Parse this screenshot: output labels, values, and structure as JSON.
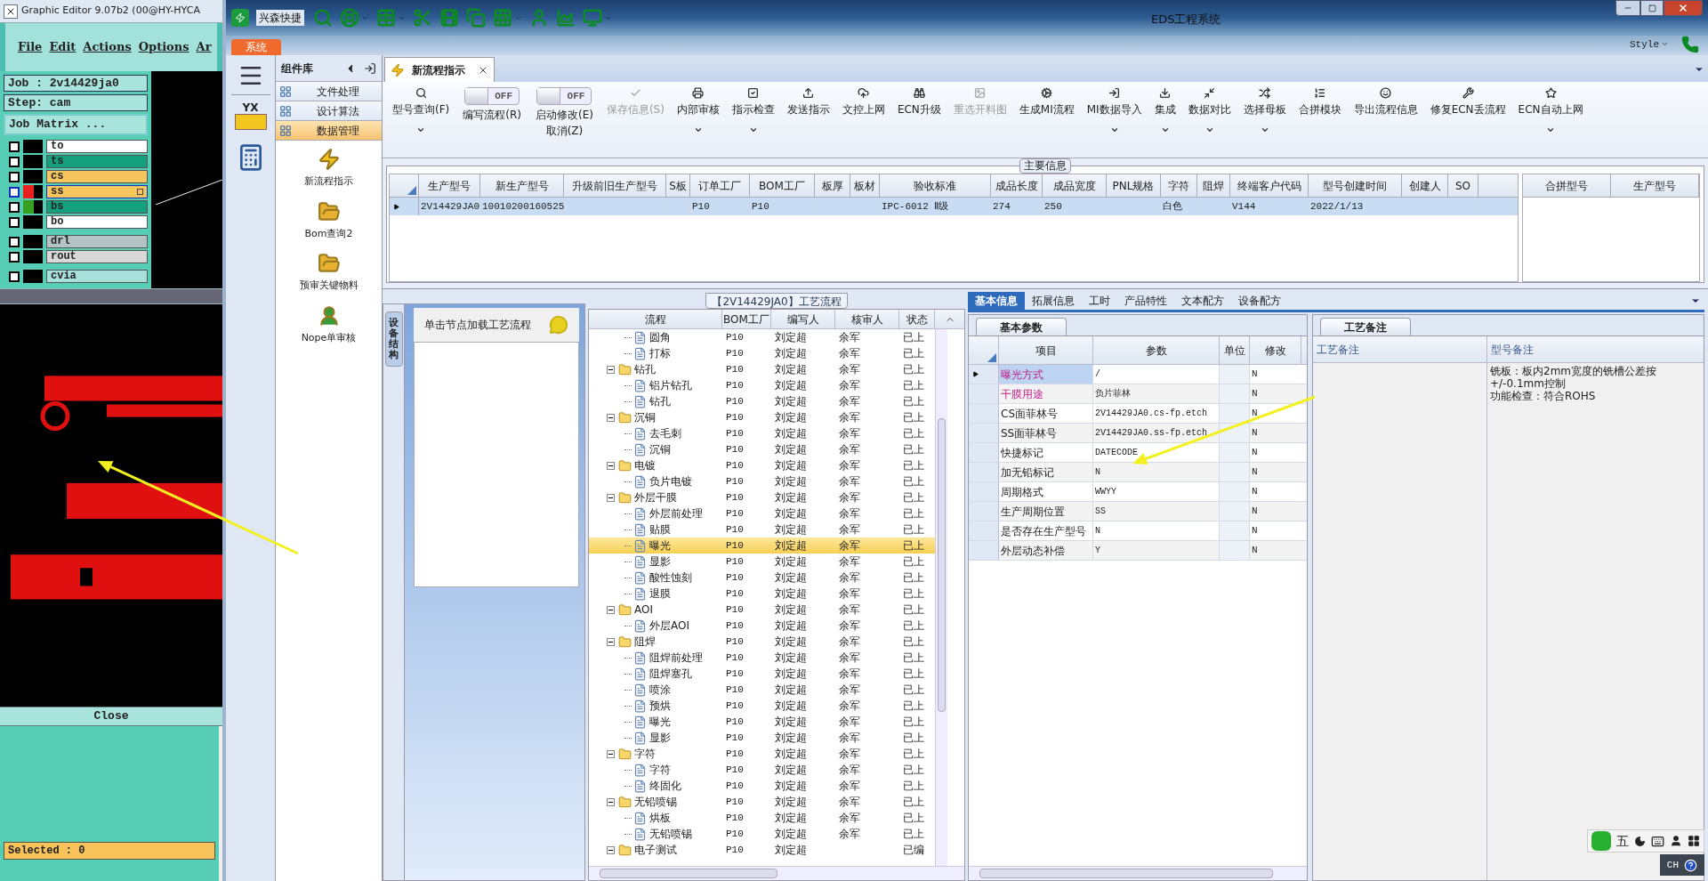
{
  "cam_window": {
    "title": "Graphic Editor 9.07b2 (00@HY-HYCA",
    "menu": [
      "File",
      "Edit",
      "Actions",
      "Options",
      "Ar"
    ],
    "job": "Job : 2v14429ja0",
    "step": "Step: cam",
    "job_matrix_button": "Job Matrix ...",
    "layers": [
      {
        "name": "to",
        "color": "#ffffff",
        "selected": false,
        "checked": false
      },
      {
        "name": "ts",
        "color": "#14a07c",
        "selected": false,
        "checked": false
      },
      {
        "name": "cs",
        "color": "#f7c55e",
        "selected": false,
        "checked": false
      },
      {
        "name": "ss",
        "color": "#f7c55e",
        "selected": true,
        "checked": false,
        "swatch": {
          "color": "#e82020"
        }
      },
      {
        "name": "bs",
        "color": "#14a07c",
        "selected": false,
        "checked": false,
        "swatch": {
          "color": "#38a020"
        }
      },
      {
        "name": "bo",
        "color": "#ffffff",
        "selected": false,
        "checked": false
      },
      {
        "name": "drl",
        "color": "#b4c4c4",
        "selected": false,
        "checked": false
      },
      {
        "name": "rout",
        "color": "#d8d8d8",
        "selected": false,
        "checked": false
      },
      {
        "name": "cvia",
        "color": "#a8e0dc",
        "selected": false,
        "checked": false
      }
    ],
    "close_button": "Close",
    "selected_status": "Selected : 0"
  },
  "main_window": {
    "title": "EDS工程系统",
    "quick_toolbar_label": "兴森快捷",
    "system_tab": "系统",
    "style_menu": "Style",
    "logo_text": "YX"
  },
  "sidebar": {
    "title": "组件库",
    "groups": [
      {
        "label": "文件处理",
        "selected": false
      },
      {
        "label": "设计算法",
        "selected": false
      },
      {
        "label": "数据管理",
        "selected": true
      }
    ],
    "items": [
      "新流程指示",
      "Bom查询2",
      "预审关键物料",
      "Nope单审核"
    ]
  },
  "document_tab": {
    "label": "新流程指示"
  },
  "toolbar": [
    {
      "kind": "button",
      "label": "型号查询(F)",
      "dropdown": true,
      "disabled": false
    },
    {
      "kind": "toggle",
      "label": "编写流程(R)",
      "toggle_text": "OFF",
      "on": false
    },
    {
      "kind": "toggle",
      "label": "启动修改(E)",
      "sublabel": "取消(Z)",
      "toggle_text": "OFF",
      "on": false
    },
    {
      "kind": "button",
      "label": "保存信息(S)",
      "dropdown": false,
      "disabled": true
    },
    {
      "kind": "button",
      "label": "内部审核",
      "dropdown": true,
      "disabled": false
    },
    {
      "kind": "button",
      "label": "指示检查",
      "dropdown": true,
      "disabled": false
    },
    {
      "kind": "button",
      "label": "发送指示",
      "dropdown": false,
      "disabled": false
    },
    {
      "kind": "button",
      "label": "文控上网",
      "dropdown": false,
      "disabled": false
    },
    {
      "kind": "button",
      "label": "ECN升级",
      "dropdown": false,
      "disabled": false
    },
    {
      "kind": "button",
      "label": "重选开料图",
      "dropdown": false,
      "disabled": true
    },
    {
      "kind": "button",
      "label": "生成MI流程",
      "dropdown": false,
      "disabled": false
    },
    {
      "kind": "button",
      "label": "MI数据导入",
      "dropdown": true,
      "disabled": false
    },
    {
      "kind": "button",
      "label": "集成",
      "dropdown": true,
      "disabled": false
    },
    {
      "kind": "button",
      "label": "数据对比",
      "dropdown": true,
      "disabled": false
    },
    {
      "kind": "button",
      "label": "选择母板",
      "dropdown": true,
      "disabled": false
    },
    {
      "kind": "button",
      "label": "合拼模块",
      "dropdown": false,
      "disabled": false
    },
    {
      "kind": "button",
      "label": "导出流程信息",
      "dropdown": false,
      "disabled": false
    },
    {
      "kind": "button",
      "label": "修复ECN丢流程",
      "dropdown": false,
      "disabled": false
    },
    {
      "kind": "button",
      "label": "ECN自动上网",
      "dropdown": true,
      "disabled": false
    }
  ],
  "main_info": {
    "title": "主要信息",
    "columns": [
      "生产型号",
      "新生产型号",
      "升级前旧生产型号",
      "S板",
      "订单工厂",
      "BOM工厂",
      "板厚",
      "板材",
      "验收标准",
      "成品长度",
      "成品宽度",
      "PNL规格",
      "字符",
      "阻焊",
      "终端客户代码",
      "型号创建时间",
      "创建人",
      "SO"
    ],
    "rows": [
      {
        "selected": true,
        "cells": [
          "2V14429JA0",
          "10010200160525",
          "",
          "",
          "P10",
          "P10",
          "",
          "",
          "IPC-6012 Ⅱ级",
          "274",
          "250",
          "",
          "白色",
          "",
          "V144",
          "2022/1/13",
          "",
          ""
        ]
      }
    ],
    "merge_columns": [
      "合拼型号",
      "生产型号"
    ]
  },
  "flow_panel": {
    "side_tab": "设备结构",
    "hint": "单击节点加载工艺流程"
  },
  "flow_tree": {
    "title": "【2V14429JA0】工艺流程",
    "columns": [
      "流程",
      "BOM工厂",
      "编写人",
      "核审人",
      "状态"
    ],
    "nodes": [
      {
        "kind": "step",
        "name": "圆角",
        "bom": "P10",
        "writer": "刘定超",
        "reviewer": "余军",
        "status": "已上",
        "selected": false
      },
      {
        "kind": "step",
        "name": "打标",
        "bom": "P10",
        "writer": "刘定超",
        "reviewer": "余军",
        "status": "已上",
        "selected": false
      },
      {
        "kind": "folder",
        "name": "钻孔",
        "bom": "P10",
        "writer": "刘定超",
        "reviewer": "余军",
        "status": "已上",
        "selected": false,
        "expanded": true,
        "children": [
          {
            "kind": "step",
            "name": "铝片钻孔",
            "bom": "P10",
            "writer": "刘定超",
            "reviewer": "余军",
            "status": "已上",
            "selected": false
          },
          {
            "kind": "step",
            "name": "钻孔",
            "bom": "P10",
            "writer": "刘定超",
            "reviewer": "余军",
            "status": "已上",
            "selected": false
          }
        ]
      },
      {
        "kind": "folder",
        "name": "沉铜",
        "bom": "P10",
        "writer": "刘定超",
        "reviewer": "余军",
        "status": "已上",
        "selected": false,
        "expanded": true,
        "children": [
          {
            "kind": "step",
            "name": "去毛刺",
            "bom": "P10",
            "writer": "刘定超",
            "reviewer": "余军",
            "status": "已上",
            "selected": false
          },
          {
            "kind": "step",
            "name": "沉铜",
            "bom": "P10",
            "writer": "刘定超",
            "reviewer": "余军",
            "status": "已上",
            "selected": false
          }
        ]
      },
      {
        "kind": "folder",
        "name": "电镀",
        "bom": "P10",
        "writer": "刘定超",
        "reviewer": "余军",
        "status": "已上",
        "selected": false,
        "expanded": true,
        "children": [
          {
            "kind": "step",
            "name": "负片电镀",
            "bom": "P10",
            "writer": "刘定超",
            "reviewer": "余军",
            "status": "已上",
            "selected": false
          }
        ]
      },
      {
        "kind": "folder",
        "name": "外层干膜",
        "bom": "P10",
        "writer": "刘定超",
        "reviewer": "余军",
        "status": "已上",
        "selected": false,
        "expanded": true,
        "children": [
          {
            "kind": "step",
            "name": "外层前处理",
            "bom": "P10",
            "writer": "刘定超",
            "reviewer": "余军",
            "status": "已上",
            "selected": false
          },
          {
            "kind": "step",
            "name": "贴膜",
            "bom": "P10",
            "writer": "刘定超",
            "reviewer": "余军",
            "status": "已上",
            "selected": false
          },
          {
            "kind": "step",
            "name": "曝光",
            "bom": "P10",
            "writer": "刘定超",
            "reviewer": "余军",
            "status": "已上",
            "selected": true
          },
          {
            "kind": "step",
            "name": "显影",
            "bom": "P10",
            "writer": "刘定超",
            "reviewer": "余军",
            "status": "已上",
            "selected": false
          },
          {
            "kind": "step",
            "name": "酸性蚀刻",
            "bom": "P10",
            "writer": "刘定超",
            "reviewer": "余军",
            "status": "已上",
            "selected": false
          },
          {
            "kind": "step",
            "name": "退膜",
            "bom": "P10",
            "writer": "刘定超",
            "reviewer": "余军",
            "status": "已上",
            "selected": false
          }
        ]
      },
      {
        "kind": "folder",
        "name": "AOI",
        "bom": "P10",
        "writer": "刘定超",
        "reviewer": "余军",
        "status": "已上",
        "selected": false,
        "expanded": true,
        "children": [
          {
            "kind": "step",
            "name": "外层AOI",
            "bom": "P10",
            "writer": "刘定超",
            "reviewer": "余军",
            "status": "已上",
            "selected": false
          }
        ]
      },
      {
        "kind": "folder",
        "name": "阻焊",
        "bom": "P10",
        "writer": "刘定超",
        "reviewer": "余军",
        "status": "已上",
        "selected": false,
        "expanded": true,
        "children": [
          {
            "kind": "step",
            "name": "阻焊前处理",
            "bom": "P10",
            "writer": "刘定超",
            "reviewer": "余军",
            "status": "已上",
            "selected": false
          },
          {
            "kind": "step",
            "name": "阻焊塞孔",
            "bom": "P10",
            "writer": "刘定超",
            "reviewer": "余军",
            "status": "已上",
            "selected": false
          },
          {
            "kind": "step",
            "name": "喷涂",
            "bom": "P10",
            "writer": "刘定超",
            "reviewer": "余军",
            "status": "已上",
            "selected": false
          },
          {
            "kind": "step",
            "name": "预烘",
            "bom": "P10",
            "writer": "刘定超",
            "reviewer": "余军",
            "status": "已上",
            "selected": false
          },
          {
            "kind": "step",
            "name": "曝光",
            "bom": "P10",
            "writer": "刘定超",
            "reviewer": "余军",
            "status": "已上",
            "selected": false
          },
          {
            "kind": "step",
            "name": "显影",
            "bom": "P10",
            "writer": "刘定超",
            "reviewer": "余军",
            "status": "已上",
            "selected": false
          }
        ]
      },
      {
        "kind": "folder",
        "name": "字符",
        "bom": "P10",
        "writer": "刘定超",
        "reviewer": "余军",
        "status": "已上",
        "selected": false,
        "expanded": true,
        "children": [
          {
            "kind": "step",
            "name": "字符",
            "bom": "P10",
            "writer": "刘定超",
            "reviewer": "余军",
            "status": "已上",
            "selected": false
          },
          {
            "kind": "step",
            "name": "终固化",
            "bom": "P10",
            "writer": "刘定超",
            "reviewer": "余军",
            "status": "已上",
            "selected": false
          }
        ]
      },
      {
        "kind": "folder",
        "name": "无铅喷锡",
        "bom": "P10",
        "writer": "刘定超",
        "reviewer": "余军",
        "status": "已上",
        "selected": false,
        "expanded": true,
        "children": [
          {
            "kind": "step",
            "name": "烘板",
            "bom": "P10",
            "writer": "刘定超",
            "reviewer": "余军",
            "status": "已上",
            "selected": false
          },
          {
            "kind": "step",
            "name": "无铅喷锡",
            "bom": "P10",
            "writer": "刘定超",
            "reviewer": "余军",
            "status": "已上",
            "selected": false
          }
        ]
      },
      {
        "kind": "folder",
        "name": "电子测试",
        "bom": "P10",
        "writer": "刘定超",
        "status": "已编",
        "selected": false,
        "expanded": true
      }
    ]
  },
  "detail_tabs": [
    {
      "label": "基本信息",
      "selected": true
    },
    {
      "label": "拓展信息",
      "selected": false
    },
    {
      "label": "工时",
      "selected": false
    },
    {
      "label": "产品特性",
      "selected": false
    },
    {
      "label": "文本配方",
      "selected": false
    },
    {
      "label": "设备配方",
      "selected": false
    }
  ],
  "params": {
    "tab": "基本参数",
    "columns": [
      "项目",
      "参数",
      "单位",
      "修改"
    ],
    "rows": [
      {
        "item": "曝光方式",
        "value": "/",
        "modified": "N",
        "required": true,
        "selected": true
      },
      {
        "item": "干膜用途",
        "value": "负片菲林",
        "modified": "N",
        "required": true,
        "selected": false
      },
      {
        "item": "CS面菲林号",
        "value": "2V14429JA0.cs-fp.etch",
        "modified": "N",
        "required": false,
        "selected": false
      },
      {
        "item": "SS面菲林号",
        "value": "2V14429JA0.ss-fp.etch",
        "modified": "N",
        "required": false,
        "selected": false
      },
      {
        "item": "快捷标记",
        "value": "DATECODE",
        "modified": "N",
        "required": false,
        "selected": false
      },
      {
        "item": "加无铅标记",
        "value": "N",
        "modified": "N",
        "required": false,
        "selected": false
      },
      {
        "item": "周期格式",
        "value": "WWYY",
        "modified": "N",
        "required": false,
        "selected": false
      },
      {
        "item": "生产周期位置",
        "value": "SS",
        "modified": "N",
        "required": false,
        "selected": false
      },
      {
        "item": "是否存在生产型号",
        "value": "N",
        "modified": "N",
        "required": false,
        "selected": false
      },
      {
        "item": "外层动态补偿",
        "value": "Y",
        "modified": "N",
        "required": false,
        "selected": false
      }
    ]
  },
  "notes": {
    "tab": "工艺备注",
    "columns": [
      "工艺备注",
      "型号备注"
    ],
    "model_note_lines": [
      "铣板：板内2mm宽度的铣槽公差按+/-0.1mm控制",
      "功能检查：符合ROHS"
    ]
  },
  "ime": {
    "mode": "五",
    "lang": "CH"
  }
}
